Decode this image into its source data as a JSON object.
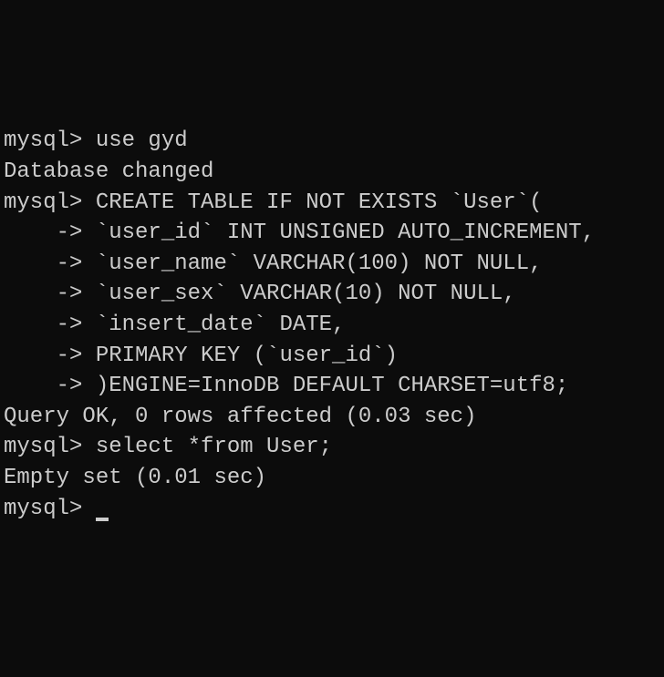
{
  "terminal": {
    "lines": [
      "mysql> use gyd",
      "Database changed",
      "mysql> CREATE TABLE IF NOT EXISTS `User`(",
      "    -> `user_id` INT UNSIGNED AUTO_INCREMENT,",
      "    -> `user_name` VARCHAR(100) NOT NULL,",
      "    -> `user_sex` VARCHAR(10) NOT NULL,",
      "    -> `insert_date` DATE,",
      "    -> PRIMARY KEY (`user_id`)",
      "    -> )ENGINE=InnoDB DEFAULT CHARSET=utf8;",
      "Query OK, 0 rows affected (0.03 sec)",
      "",
      "mysql> select *from User;",
      "Empty set (0.01 sec)",
      "",
      "mysql> "
    ]
  }
}
